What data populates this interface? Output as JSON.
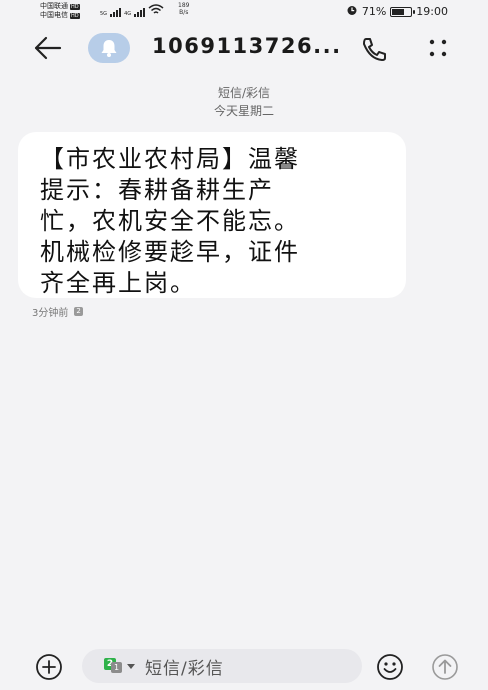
{
  "status_bar": {
    "carrier1": "中国联通",
    "carrier2": "中国电信",
    "hd": "HD",
    "net1": "5G",
    "net2": "4G",
    "speed_value": "189",
    "speed_unit": "B/s",
    "battery": "71%",
    "battery_level": 0.71,
    "time": "19:00"
  },
  "header": {
    "contact": "1069113726..."
  },
  "thread": {
    "type": "短信/彩信",
    "day": "今天星期二"
  },
  "message": {
    "lines": [
      "【市农业农村局】温馨",
      "提示：春耕备耕生产",
      "忙，农机安全不能忘。",
      "机械检修要趁早，证件",
      "齐全再上岗。"
    ],
    "time": "3分钟前",
    "sim": "2"
  },
  "composer": {
    "sim_primary": "2",
    "sim_secondary": "1",
    "placeholder": "短信/彩信"
  },
  "icons": {
    "back": "arrow-left-icon",
    "avatar": "bell-icon",
    "call": "phone-icon",
    "more": "more-dots-icon",
    "add": "plus-circle-icon",
    "emoji": "smiley-icon",
    "send": "send-arrow-icon"
  }
}
